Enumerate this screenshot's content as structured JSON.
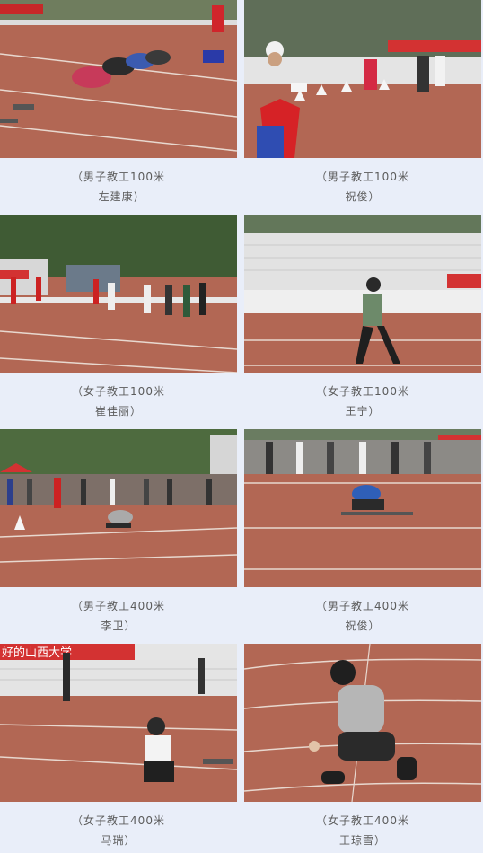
{
  "items": [
    {
      "event": "（男子教工100米",
      "name": "左建康)",
      "photo_icon": "sprint-start-photo"
    },
    {
      "event": "（男子教工100米",
      "name": "祝俊）",
      "photo_icon": "starter-official-photo"
    },
    {
      "event": "（女子教工100米",
      "name": "崔佳丽）",
      "photo_icon": "female-runners-photo"
    },
    {
      "event": "（女子教工100米",
      "name": "王宁）",
      "photo_icon": "female-sprinter-photo"
    },
    {
      "event": "（男子教工400米",
      "name": "李卫）",
      "photo_icon": "crowd-start-photo"
    },
    {
      "event": "（男子教工400米",
      "name": "祝俊）",
      "photo_icon": "crouch-start-photo"
    },
    {
      "event": "（女子教工400米",
      "name": "马瑞）",
      "photo_icon": "female-crouch-photo"
    },
    {
      "event": "（女子教工400米",
      "name": "王琼雪）",
      "photo_icon": "closeup-crouch-photo"
    }
  ],
  "banner_texts": [
    "好的山西大学"
  ],
  "colors": {
    "background": "#e9eef9",
    "track": "#b26754",
    "caption": "#5b5b5b"
  }
}
